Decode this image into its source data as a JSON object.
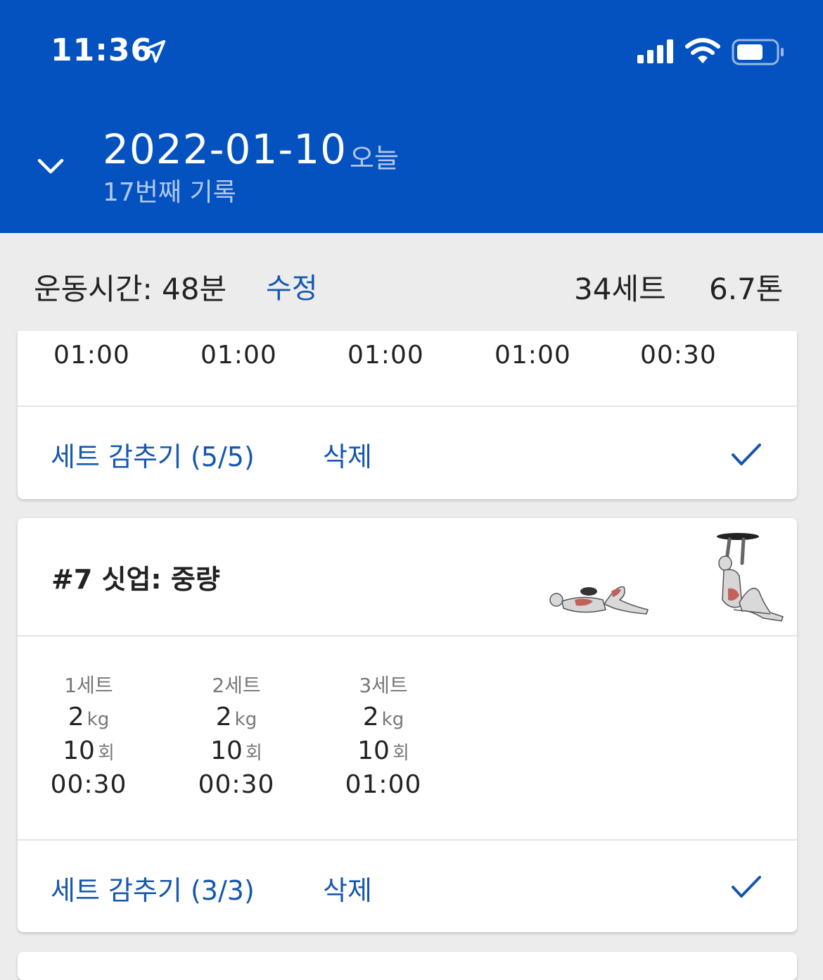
{
  "status_bar": {
    "time": "11:36"
  },
  "header": {
    "date": "2022-01-10",
    "today_label": "오늘",
    "record_label": "17번째 기록"
  },
  "summary": {
    "workout_time": "운동시간: 48분",
    "edit_label": "수정",
    "sets_total": "34세트",
    "volume_total": "6.7톤"
  },
  "card_prev": {
    "times": [
      "01:00",
      "01:00",
      "01:00",
      "01:00",
      "00:30"
    ],
    "hide_sets_label": "세트 감추기 (5/5)",
    "delete_label": "삭제"
  },
  "card_exercise": {
    "title": "#7 싯업: 중량",
    "sets": [
      {
        "label": "1세트",
        "weight": "2",
        "weight_unit": "kg",
        "reps": "10",
        "reps_unit": "회",
        "duration": "00:30"
      },
      {
        "label": "2세트",
        "weight": "2",
        "weight_unit": "kg",
        "reps": "10",
        "reps_unit": "회",
        "duration": "00:30"
      },
      {
        "label": "3세트",
        "weight": "2",
        "weight_unit": "kg",
        "reps": "10",
        "reps_unit": "회",
        "duration": "01:00"
      }
    ],
    "hide_sets_label": "세트 감추기 (3/3)",
    "delete_label": "삭제"
  },
  "colors": {
    "header_bg": "#0352c0",
    "accent": "#1557b0"
  },
  "icons": [
    "location-arrow-icon",
    "signal-icon",
    "wifi-icon",
    "battery-icon",
    "chevron-down-icon",
    "check-icon"
  ]
}
